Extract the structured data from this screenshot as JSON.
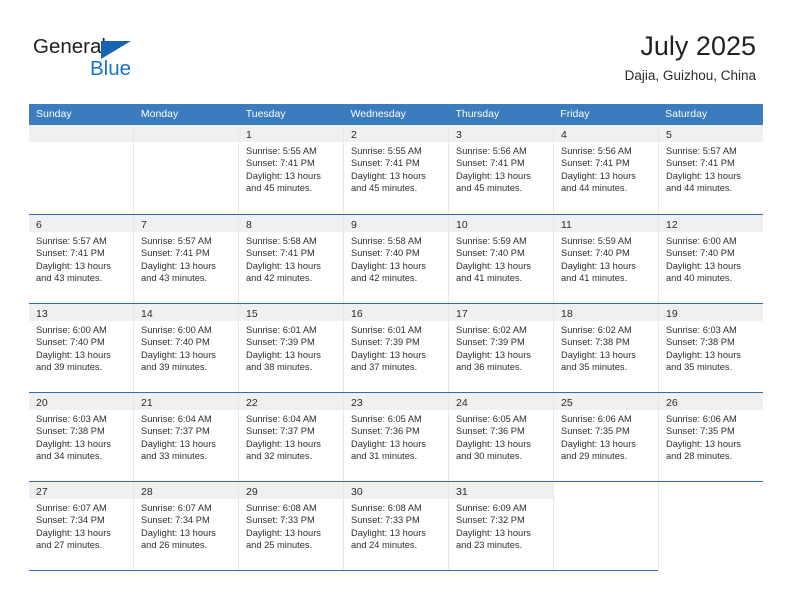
{
  "brand": {
    "name_top": "General",
    "name_bottom": "Blue",
    "accent_color": "#1575c4",
    "triangle_color": "#1565b0"
  },
  "header": {
    "title": "July 2025",
    "subtitle": "Dajia, Guizhou, China"
  },
  "theme": {
    "header_row_color": "#3a7cbe",
    "row_divider_color": "#2f6fb0",
    "date_band_color": "#f0f0f0",
    "text_color": "#2f2f2f"
  },
  "weekdays": [
    "Sunday",
    "Monday",
    "Tuesday",
    "Wednesday",
    "Thursday",
    "Friday",
    "Saturday"
  ],
  "weeks": [
    [
      {
        "date": "",
        "blank": true
      },
      {
        "date": "",
        "blank": true
      },
      {
        "date": "1",
        "sunrise": "Sunrise: 5:55 AM",
        "sunset": "Sunset: 7:41 PM",
        "daylight_1": "Daylight: 13 hours",
        "daylight_2": "and 45 minutes."
      },
      {
        "date": "2",
        "sunrise": "Sunrise: 5:55 AM",
        "sunset": "Sunset: 7:41 PM",
        "daylight_1": "Daylight: 13 hours",
        "daylight_2": "and 45 minutes."
      },
      {
        "date": "3",
        "sunrise": "Sunrise: 5:56 AM",
        "sunset": "Sunset: 7:41 PM",
        "daylight_1": "Daylight: 13 hours",
        "daylight_2": "and 45 minutes."
      },
      {
        "date": "4",
        "sunrise": "Sunrise: 5:56 AM",
        "sunset": "Sunset: 7:41 PM",
        "daylight_1": "Daylight: 13 hours",
        "daylight_2": "and 44 minutes."
      },
      {
        "date": "5",
        "sunrise": "Sunrise: 5:57 AM",
        "sunset": "Sunset: 7:41 PM",
        "daylight_1": "Daylight: 13 hours",
        "daylight_2": "and 44 minutes."
      }
    ],
    [
      {
        "date": "6",
        "sunrise": "Sunrise: 5:57 AM",
        "sunset": "Sunset: 7:41 PM",
        "daylight_1": "Daylight: 13 hours",
        "daylight_2": "and 43 minutes."
      },
      {
        "date": "7",
        "sunrise": "Sunrise: 5:57 AM",
        "sunset": "Sunset: 7:41 PM",
        "daylight_1": "Daylight: 13 hours",
        "daylight_2": "and 43 minutes."
      },
      {
        "date": "8",
        "sunrise": "Sunrise: 5:58 AM",
        "sunset": "Sunset: 7:41 PM",
        "daylight_1": "Daylight: 13 hours",
        "daylight_2": "and 42 minutes."
      },
      {
        "date": "9",
        "sunrise": "Sunrise: 5:58 AM",
        "sunset": "Sunset: 7:40 PM",
        "daylight_1": "Daylight: 13 hours",
        "daylight_2": "and 42 minutes."
      },
      {
        "date": "10",
        "sunrise": "Sunrise: 5:59 AM",
        "sunset": "Sunset: 7:40 PM",
        "daylight_1": "Daylight: 13 hours",
        "daylight_2": "and 41 minutes."
      },
      {
        "date": "11",
        "sunrise": "Sunrise: 5:59 AM",
        "sunset": "Sunset: 7:40 PM",
        "daylight_1": "Daylight: 13 hours",
        "daylight_2": "and 41 minutes."
      },
      {
        "date": "12",
        "sunrise": "Sunrise: 6:00 AM",
        "sunset": "Sunset: 7:40 PM",
        "daylight_1": "Daylight: 13 hours",
        "daylight_2": "and 40 minutes."
      }
    ],
    [
      {
        "date": "13",
        "sunrise": "Sunrise: 6:00 AM",
        "sunset": "Sunset: 7:40 PM",
        "daylight_1": "Daylight: 13 hours",
        "daylight_2": "and 39 minutes."
      },
      {
        "date": "14",
        "sunrise": "Sunrise: 6:00 AM",
        "sunset": "Sunset: 7:40 PM",
        "daylight_1": "Daylight: 13 hours",
        "daylight_2": "and 39 minutes."
      },
      {
        "date": "15",
        "sunrise": "Sunrise: 6:01 AM",
        "sunset": "Sunset: 7:39 PM",
        "daylight_1": "Daylight: 13 hours",
        "daylight_2": "and 38 minutes."
      },
      {
        "date": "16",
        "sunrise": "Sunrise: 6:01 AM",
        "sunset": "Sunset: 7:39 PM",
        "daylight_1": "Daylight: 13 hours",
        "daylight_2": "and 37 minutes."
      },
      {
        "date": "17",
        "sunrise": "Sunrise: 6:02 AM",
        "sunset": "Sunset: 7:39 PM",
        "daylight_1": "Daylight: 13 hours",
        "daylight_2": "and 36 minutes."
      },
      {
        "date": "18",
        "sunrise": "Sunrise: 6:02 AM",
        "sunset": "Sunset: 7:38 PM",
        "daylight_1": "Daylight: 13 hours",
        "daylight_2": "and 35 minutes."
      },
      {
        "date": "19",
        "sunrise": "Sunrise: 6:03 AM",
        "sunset": "Sunset: 7:38 PM",
        "daylight_1": "Daylight: 13 hours",
        "daylight_2": "and 35 minutes."
      }
    ],
    [
      {
        "date": "20",
        "sunrise": "Sunrise: 6:03 AM",
        "sunset": "Sunset: 7:38 PM",
        "daylight_1": "Daylight: 13 hours",
        "daylight_2": "and 34 minutes."
      },
      {
        "date": "21",
        "sunrise": "Sunrise: 6:04 AM",
        "sunset": "Sunset: 7:37 PM",
        "daylight_1": "Daylight: 13 hours",
        "daylight_2": "and 33 minutes."
      },
      {
        "date": "22",
        "sunrise": "Sunrise: 6:04 AM",
        "sunset": "Sunset: 7:37 PM",
        "daylight_1": "Daylight: 13 hours",
        "daylight_2": "and 32 minutes."
      },
      {
        "date": "23",
        "sunrise": "Sunrise: 6:05 AM",
        "sunset": "Sunset: 7:36 PM",
        "daylight_1": "Daylight: 13 hours",
        "daylight_2": "and 31 minutes."
      },
      {
        "date": "24",
        "sunrise": "Sunrise: 6:05 AM",
        "sunset": "Sunset: 7:36 PM",
        "daylight_1": "Daylight: 13 hours",
        "daylight_2": "and 30 minutes."
      },
      {
        "date": "25",
        "sunrise": "Sunrise: 6:06 AM",
        "sunset": "Sunset: 7:35 PM",
        "daylight_1": "Daylight: 13 hours",
        "daylight_2": "and 29 minutes."
      },
      {
        "date": "26",
        "sunrise": "Sunrise: 6:06 AM",
        "sunset": "Sunset: 7:35 PM",
        "daylight_1": "Daylight: 13 hours",
        "daylight_2": "and 28 minutes."
      }
    ],
    [
      {
        "date": "27",
        "sunrise": "Sunrise: 6:07 AM",
        "sunset": "Sunset: 7:34 PM",
        "daylight_1": "Daylight: 13 hours",
        "daylight_2": "and 27 minutes."
      },
      {
        "date": "28",
        "sunrise": "Sunrise: 6:07 AM",
        "sunset": "Sunset: 7:34 PM",
        "daylight_1": "Daylight: 13 hours",
        "daylight_2": "and 26 minutes."
      },
      {
        "date": "29",
        "sunrise": "Sunrise: 6:08 AM",
        "sunset": "Sunset: 7:33 PM",
        "daylight_1": "Daylight: 13 hours",
        "daylight_2": "and 25 minutes."
      },
      {
        "date": "30",
        "sunrise": "Sunrise: 6:08 AM",
        "sunset": "Sunset: 7:33 PM",
        "daylight_1": "Daylight: 13 hours",
        "daylight_2": "and 24 minutes."
      },
      {
        "date": "31",
        "sunrise": "Sunrise: 6:09 AM",
        "sunset": "Sunset: 7:32 PM",
        "daylight_1": "Daylight: 13 hours",
        "daylight_2": "and 23 minutes."
      },
      {
        "date": "",
        "empty_tail": true
      },
      {
        "date": "",
        "empty_tail": true
      }
    ]
  ]
}
